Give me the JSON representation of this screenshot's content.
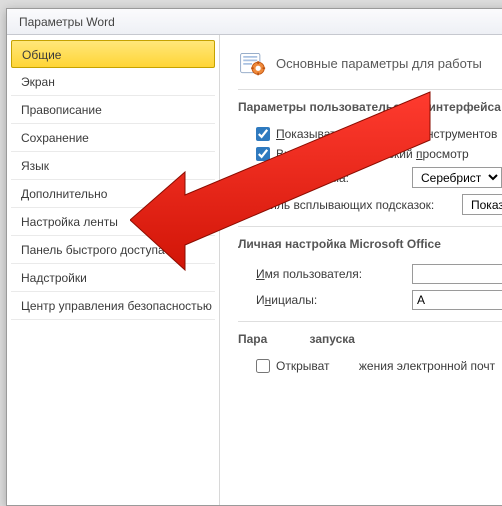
{
  "window": {
    "title": "Параметры Word"
  },
  "sidebar": {
    "items": [
      {
        "label": "Общие",
        "selected": true
      },
      {
        "label": "Экран"
      },
      {
        "label": "Правописание"
      },
      {
        "label": "Сохранение"
      },
      {
        "label": "Язык"
      },
      {
        "label": "Дополнительно"
      },
      {
        "label": "Настройка ленты"
      },
      {
        "label": "Панель быстрого доступа"
      },
      {
        "label": "Надстройки"
      },
      {
        "label": "Центр управления безопасностью"
      }
    ]
  },
  "main": {
    "heading": "Основные параметры для работы",
    "section_ui": {
      "title": "Параметры пользовательского интерфейса",
      "show_mini_toolbar": {
        "label": "Показывать мини-панель инструментов",
        "checked": true
      },
      "live_preview": {
        "label": "Включить динамический просмотр",
        "checked": true
      },
      "color_scheme": {
        "label": "Цветовая схема:",
        "value": "Серебристая"
      },
      "screentip_style": {
        "label": "Стиль всплывающих подсказок:",
        "value": "Показывать"
      }
    },
    "section_office": {
      "title": "Личная настройка Microsoft Office",
      "username": {
        "label": "Имя пользователя:",
        "value": ""
      },
      "initials": {
        "label": "Инициалы:",
        "value": "A"
      }
    },
    "section_startup": {
      "title": "Параметры запуска",
      "open_attachments": {
        "label": "Открывать вложения электронной почты",
        "checked": false
      }
    }
  }
}
